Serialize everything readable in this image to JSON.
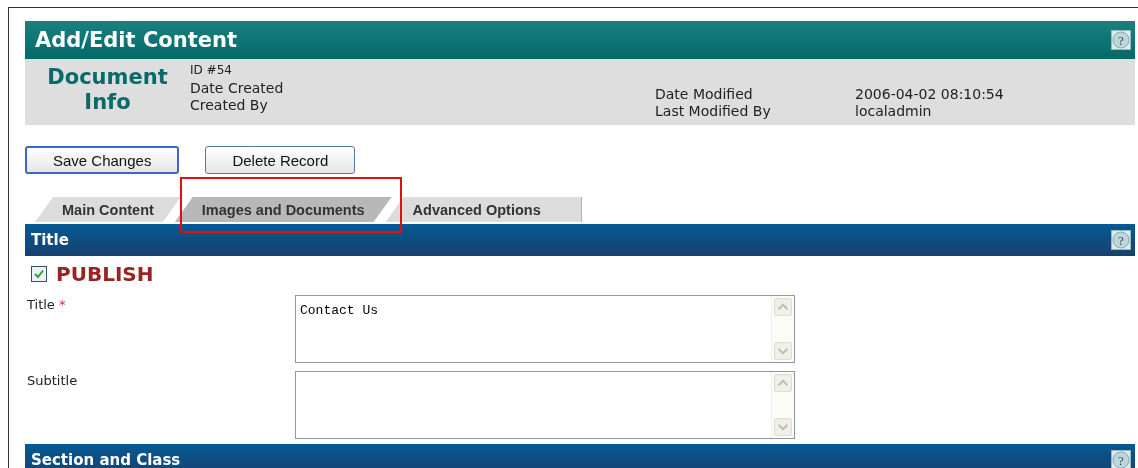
{
  "header": {
    "title": "Add/Edit Content",
    "help": "?"
  },
  "document_info": {
    "heading": "Document Info",
    "id": "ID #54",
    "left": [
      {
        "label": "Date Created"
      },
      {
        "label": "Created By"
      }
    ],
    "right": [
      {
        "label": "Date Modified",
        "value": "2006-04-02 08:10:54"
      },
      {
        "label": "Last Modified By",
        "value": "localadmin"
      }
    ]
  },
  "buttons": [
    "Save Changes",
    "Delete Record"
  ],
  "tabs": [
    {
      "label": "Main Content",
      "selected": false
    },
    {
      "label": "Images and Documents",
      "selected": true
    },
    {
      "label": "Advanced Options",
      "selected": false
    }
  ],
  "highlight_frame": true,
  "sections": [
    {
      "title": "Title",
      "help": "?",
      "publish": {
        "label": "PUBLISH",
        "checked": true
      },
      "fields": [
        {
          "label": "Title",
          "required_mark": "*",
          "value": "Contact Us"
        },
        {
          "label": "Subtitle"
        }
      ]
    },
    {
      "title": "Section and Class",
      "help": "?"
    }
  ]
}
